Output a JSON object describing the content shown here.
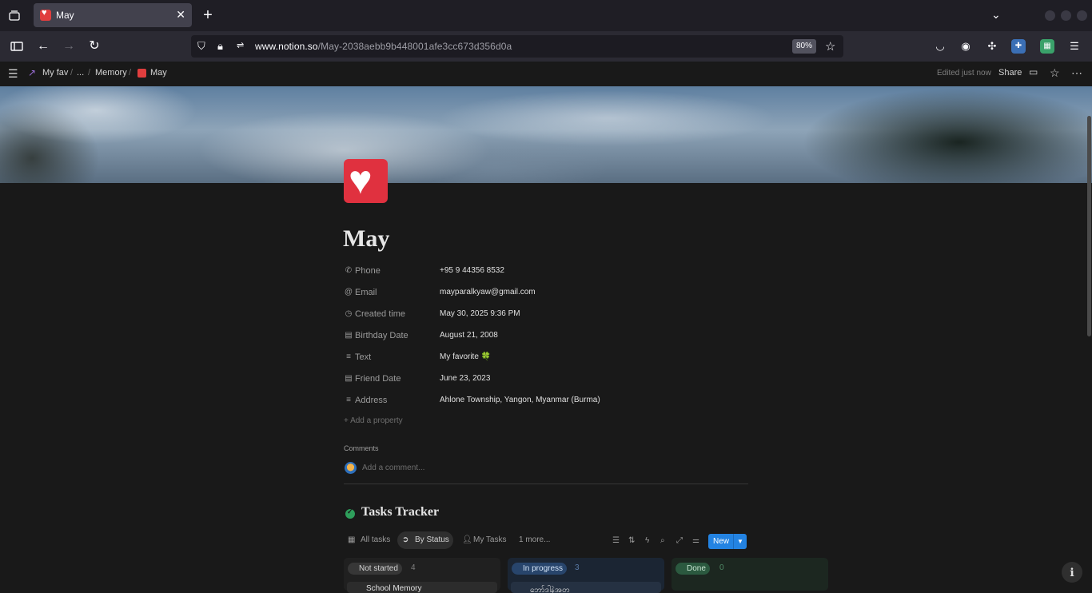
{
  "browser": {
    "tab_title": "May",
    "url_domain": "www.notion.so",
    "url_path": "/May-2038aebb9b448001afe3cc673d356d0a",
    "zoom": "80%"
  },
  "notion_top": {
    "breadcrumbs": [
      "My fav",
      "...",
      "Memory",
      "May"
    ],
    "edited": "Edited just now",
    "share": "Share"
  },
  "page": {
    "title": "May",
    "properties": [
      {
        "icon": "phone-icon",
        "name": "Phone",
        "value": "+95 9 44356 8532"
      },
      {
        "icon": "at-icon",
        "name": "Email",
        "value": "mayparalkyaw@gmail.com"
      },
      {
        "icon": "clock-icon",
        "name": "Created time",
        "value": "May 30, 2025 9:36 PM"
      },
      {
        "icon": "calendar-icon",
        "name": "Birthday Date",
        "value": "August 21, 2008"
      },
      {
        "icon": "text-icon",
        "name": "Text",
        "value": "My favorite 🍀"
      },
      {
        "icon": "calendar-icon",
        "name": "Friend Date",
        "value": "June 23, 2023"
      },
      {
        "icon": "text-icon",
        "name": "Address",
        "value": "Ahlone Township, Yangon, Myanmar (Burma)"
      }
    ],
    "add_property": "Add a property",
    "comments_heading": "Comments",
    "comment_placeholder": "Add a comment..."
  },
  "database": {
    "title": "Tasks Tracker",
    "views": [
      "All tasks",
      "By Status",
      "My Tasks",
      "1 more..."
    ],
    "active_view": "By Status",
    "new_label": "New",
    "columns": [
      {
        "status": "Not started",
        "count": "4",
        "card": "School Memory"
      },
      {
        "status": "In progress",
        "count": "3",
        "card": "ဘော်ဒါနဲ့အတူ"
      },
      {
        "status": "Done",
        "count": "0",
        "card": ""
      }
    ]
  },
  "colors": {
    "accent": "#2383e2",
    "not_started": "#5a5a5a",
    "in_progress": "#28456c",
    "done": "#2b593f"
  }
}
